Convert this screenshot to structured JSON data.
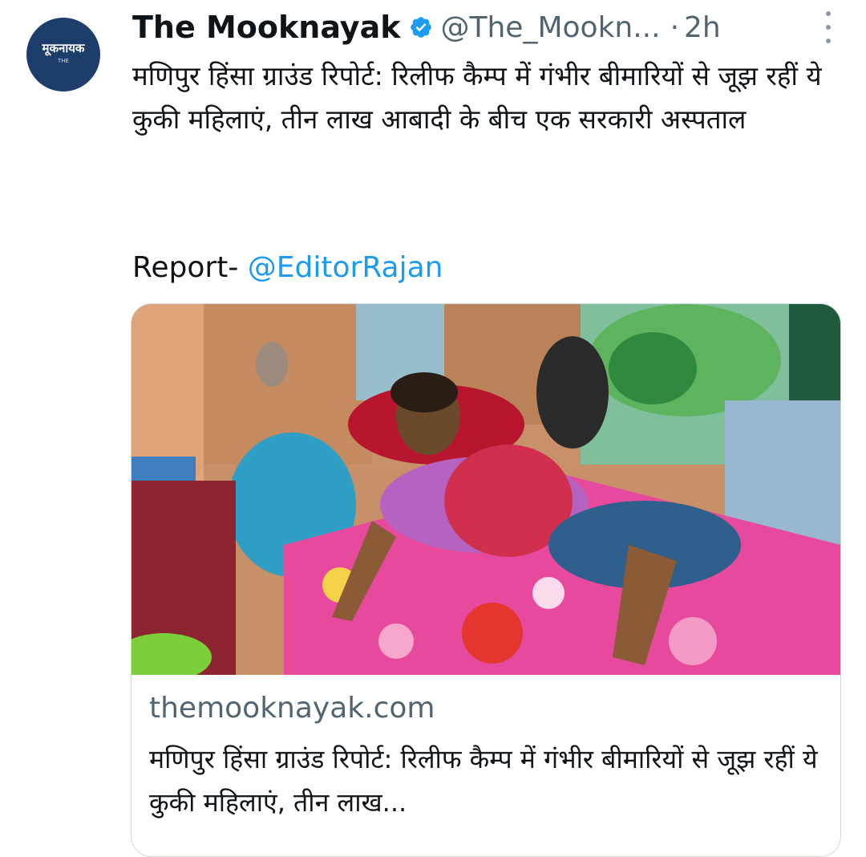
{
  "account": {
    "display_name": "The Mooknayak",
    "handle": "@The_Mookn...",
    "time_separator": "·",
    "timestamp": "2h",
    "avatar_logo_text": "मूकनायक",
    "avatar_logo_sub": "THE",
    "verified": true
  },
  "tweet": {
    "text": "मणिपुर हिंसा ग्राउंड रिपोर्ट: रिलीफ कैम्प में गंभीर बीमारियों से जूझ रहीं ये कुकी महिलाएं, तीन लाख आबादी के बीच एक सरकारी अस्पताल",
    "report_prefix": "Report- ",
    "mention": "@EditorRajan"
  },
  "link_card": {
    "domain": "themooknayak.com",
    "title": "मणिपुर हिंसा ग्राउंड रिपोर्ट: रिलीफ कैम्प में गंभीर बीमारियों से जूझ रहीं ये कुकी महिलाएं, तीन लाख..."
  },
  "icons": {
    "verified": "verified-badge-icon",
    "more": "more-options-icon"
  },
  "colors": {
    "link": "#1d9bf0",
    "secondary_text": "#536471",
    "verified": "#1d9bf0",
    "avatar_bg": "#1d3d6b"
  }
}
